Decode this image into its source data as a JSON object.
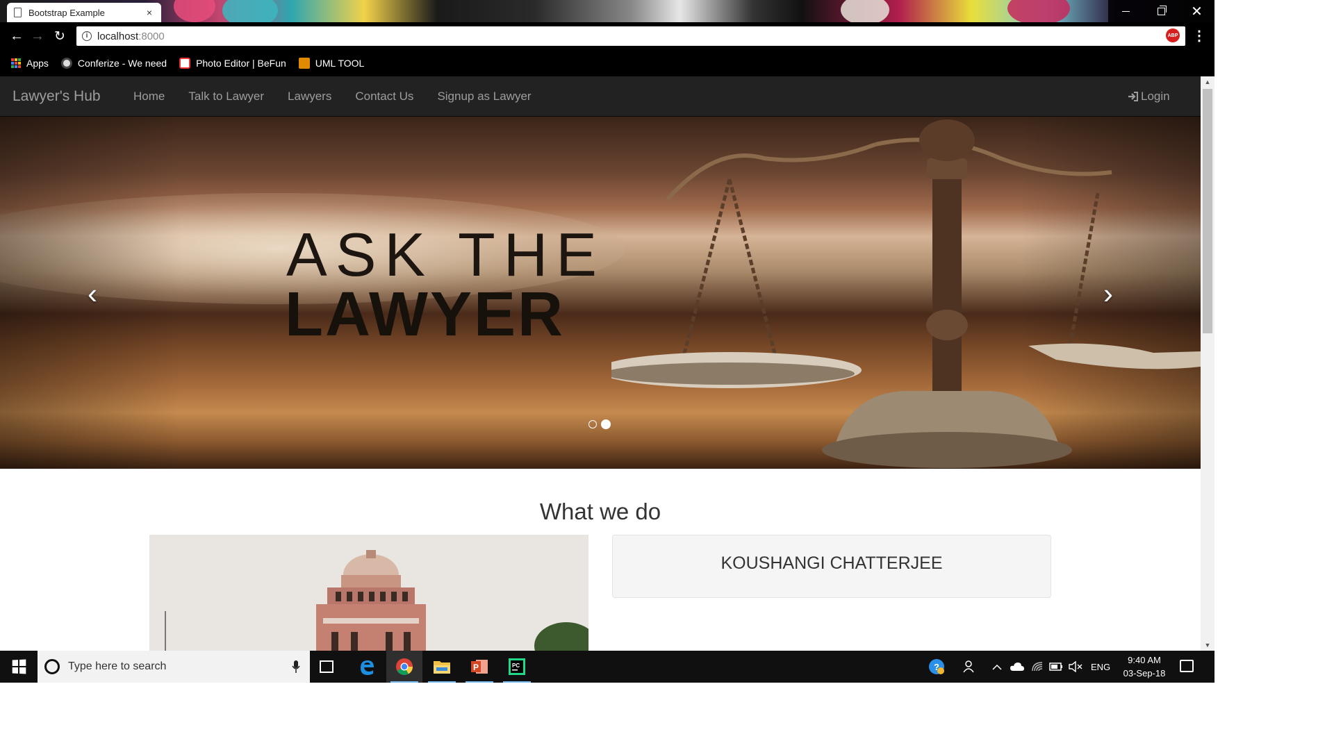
{
  "browser": {
    "tab_title": "Bootstrap Example",
    "tab_close": "×",
    "url_host": "localhost",
    "url_port": ":8000",
    "info_glyph": "i",
    "star_glyph": "☆",
    "abp_label": "ABP",
    "menu_glyph": "⋮",
    "back_glyph": "←",
    "forward_glyph": "→",
    "reload_glyph": "↻",
    "close_glyph": "✕",
    "bookmarks": [
      {
        "label": "Apps",
        "icon": "apps-grid-icon"
      },
      {
        "label": "Conferize - We need",
        "icon": "conferize-icon"
      },
      {
        "label": "Photo Editor | BeFun",
        "icon": "photo-editor-icon"
      },
      {
        "label": "UML TOOL",
        "icon": "uml-tool-icon"
      }
    ]
  },
  "site": {
    "brand": "Lawyer's Hub",
    "nav": [
      "Home",
      "Talk to Lawyer",
      "Lawyers",
      "Contact Us",
      "Signup as Lawyer"
    ],
    "login_label": "Login",
    "carousel": {
      "line1": "ASK THE",
      "line2": "LAWYER",
      "prev_glyph": "‹",
      "next_glyph": "›",
      "slide_count": 2,
      "active_slide": 2
    },
    "section_title": "What we do",
    "card_name": "KOUSHANGI CHATTERJEE"
  },
  "taskbar": {
    "search_placeholder": "Type here to search",
    "apps": [
      "task-view-icon",
      "edge-icon",
      "chrome-icon",
      "file-explorer-icon",
      "powerpoint-icon",
      "pycharm-icon"
    ],
    "powerpoint_letter": "P",
    "pycharm_letters": "PC",
    "language": "ENG",
    "time": "9:40 AM",
    "date": "03-Sep-18"
  },
  "colors": {
    "navbar_bg": "#222222",
    "nav_text": "#9d9d9d",
    "accent_underline": "#76b9ed",
    "abp_red": "#d61f1f"
  }
}
